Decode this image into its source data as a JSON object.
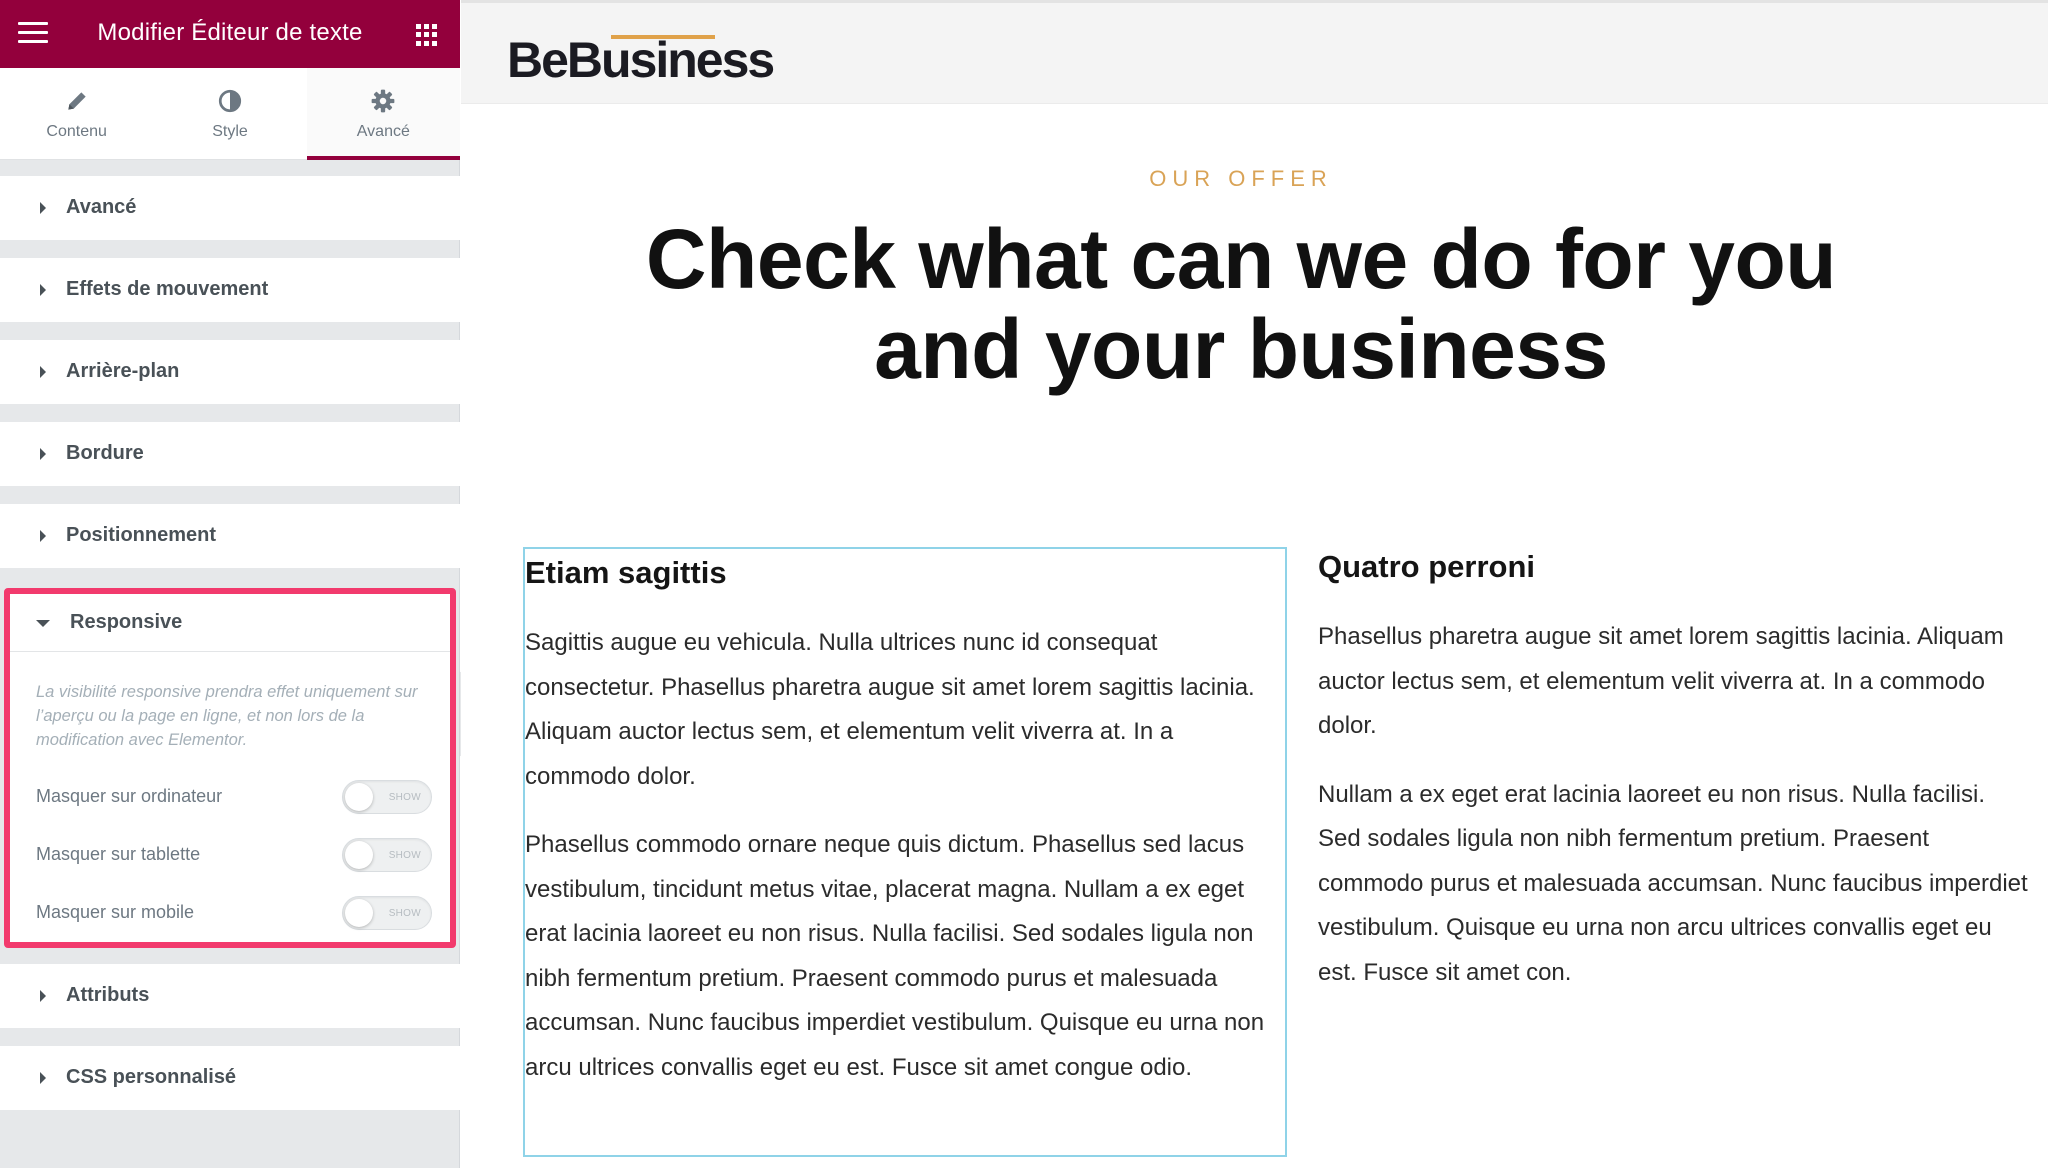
{
  "editor": {
    "title": "Modifier Éditeur de texte",
    "tabs": [
      {
        "label": "Contenu",
        "icon": "pencil-icon"
      },
      {
        "label": "Style",
        "icon": "half-circle-icon"
      },
      {
        "label": "Avancé",
        "icon": "gear-icon"
      }
    ],
    "active_tab": "Avancé",
    "sections": [
      "Avancé",
      "Effets de mouvement",
      "Arrière-plan",
      "Bordure",
      "Positionnement"
    ],
    "responsive": {
      "label": "Responsive",
      "note": "La visibilité responsive prendra effet uniquement sur l’aperçu ou la page en ligne, et non lors de la modification avec Elementor.",
      "toggles": [
        {
          "label": "Masquer sur ordinateur",
          "state": "SHOW"
        },
        {
          "label": "Masquer sur tablette",
          "state": "SHOW"
        },
        {
          "label": "Masquer sur mobile",
          "state": "SHOW"
        }
      ]
    },
    "sections_after": [
      "Attributs",
      "CSS personnalisé"
    ],
    "colors": {
      "accent": "#93003c",
      "highlight": "#f23a6d"
    }
  },
  "site": {
    "logo": "BeBusiness",
    "eyebrow": "OUR OFFER",
    "headline_line1": "Check what can we do for you",
    "headline_line2": "and your business",
    "columns": [
      {
        "title": "Etiam sagittis",
        "paragraphs": [
          "Sagittis augue eu vehicula. Nulla ultrices nunc id consequat consectetur. Phasellus pharetra augue sit amet lorem sagittis lacinia. Aliquam auctor lectus sem, et elementum velit viverra at. In a commodo dolor.",
          "Phasellus commodo ornare neque quis dictum. Phasellus sed lacus vestibulum, tincidunt metus vitae, placerat magna. Nullam a ex eget erat lacinia laoreet eu non risus. Nulla facilisi. Sed sodales ligula non nibh fermentum pretium. Praesent commodo purus et malesuada accumsan. Nunc faucibus imperdiet vestibulum. Quisque eu urna non arcu ultrices convallis eget eu est. Fusce sit amet congue odio."
        ]
      },
      {
        "title": "Quatro perroni",
        "paragraphs": [
          "Phasellus pharetra augue sit amet lorem sagittis lacinia. Aliquam auctor lectus sem, et elementum velit viverra at. In a commodo dolor.",
          "Nullam a ex eget erat lacinia laoreet eu non risus. Nulla facilisi. Sed sodales ligula non nibh fermentum pretium. Praesent commodo purus et malesuada accumsan. Nunc faucibus imperdiet vestibulum. Quisque eu urna non arcu ultrices convallis eget eu est. Fusce sit amet con."
        ]
      }
    ],
    "colors": {
      "eyebrow": "#d9a356",
      "selected_border": "#8fd3e8"
    }
  }
}
